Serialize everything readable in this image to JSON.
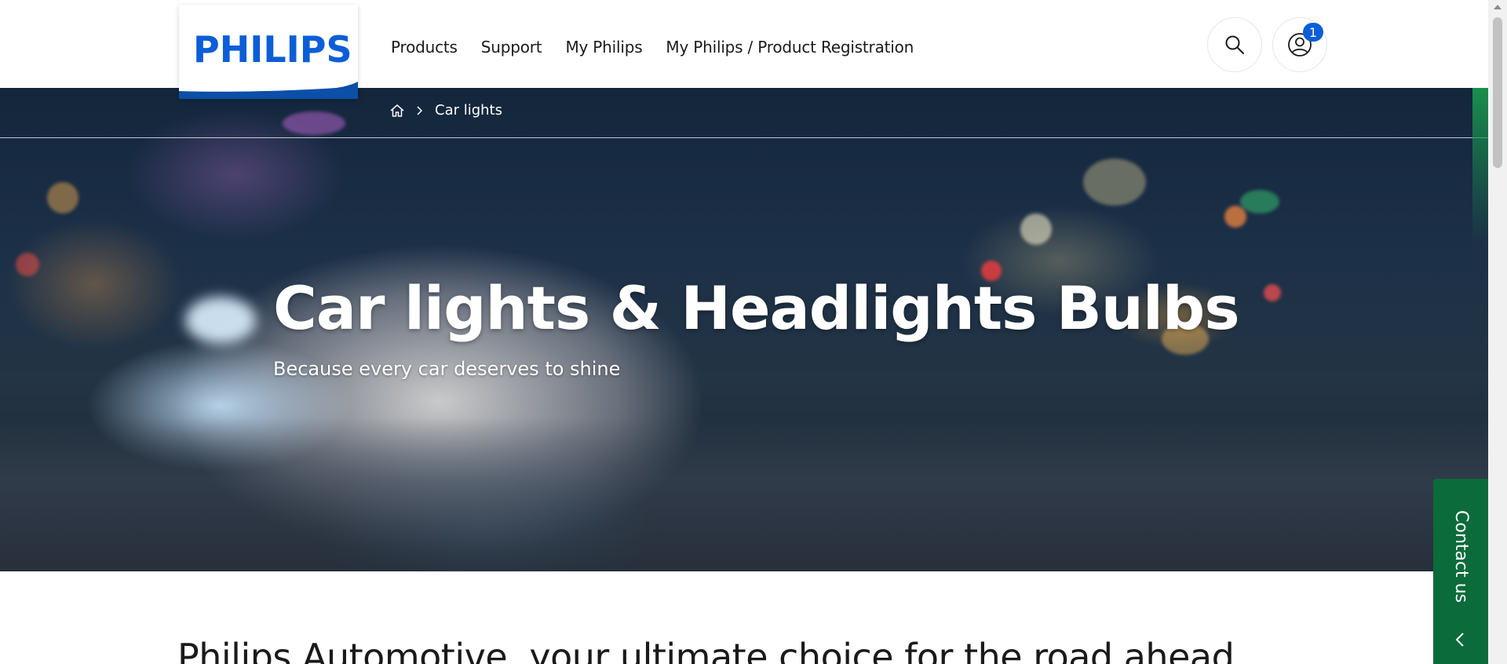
{
  "header": {
    "logo_text": "PHILIPS",
    "nav": [
      "Products",
      "Support",
      "My Philips",
      "My Philips / Product Registration"
    ],
    "search_icon": "search-icon",
    "account_icon": "user-icon",
    "account_badge": "1"
  },
  "breadcrumb": {
    "home_icon": "home-icon",
    "current": "Car lights"
  },
  "hero": {
    "title": "Car lights & Headlights Bulbs",
    "subtitle": "Because every car deserves to shine"
  },
  "intro": {
    "heading": "Philips Automotive, your ultimate choice for the road ahead"
  },
  "contact": {
    "label": "Contact us",
    "icon": "chevron-left-icon"
  },
  "colors": {
    "brand_blue": "#0b5ed7",
    "contact_green": "#0b6b3a"
  }
}
